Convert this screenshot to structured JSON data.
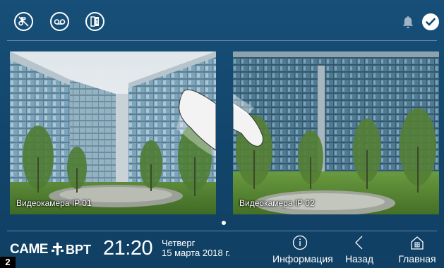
{
  "topbar": {
    "icons": [
      "mute-ringtone-icon",
      "answering-machine-icon",
      "door-status-icon",
      "bell-icon",
      "check-icon"
    ]
  },
  "cameras": [
    {
      "label": "Видеокамера IP 01"
    },
    {
      "label": "Видеокамера IP 02"
    }
  ],
  "bottom": {
    "brand": "CAME",
    "brand2": "BPT",
    "time": "21:20",
    "day": "Четверг",
    "date": "15 марта 2018 г.",
    "buttons": [
      {
        "label": "Информация",
        "icon": "info-icon"
      },
      {
        "label": "Назад",
        "icon": "back-chevron-icon"
      },
      {
        "label": "Главная",
        "icon": "home-icon"
      }
    ]
  },
  "figure_number": "2",
  "colors": {
    "background": "#14486e",
    "accent": "#ffffff",
    "separator": "#5b85a6"
  }
}
